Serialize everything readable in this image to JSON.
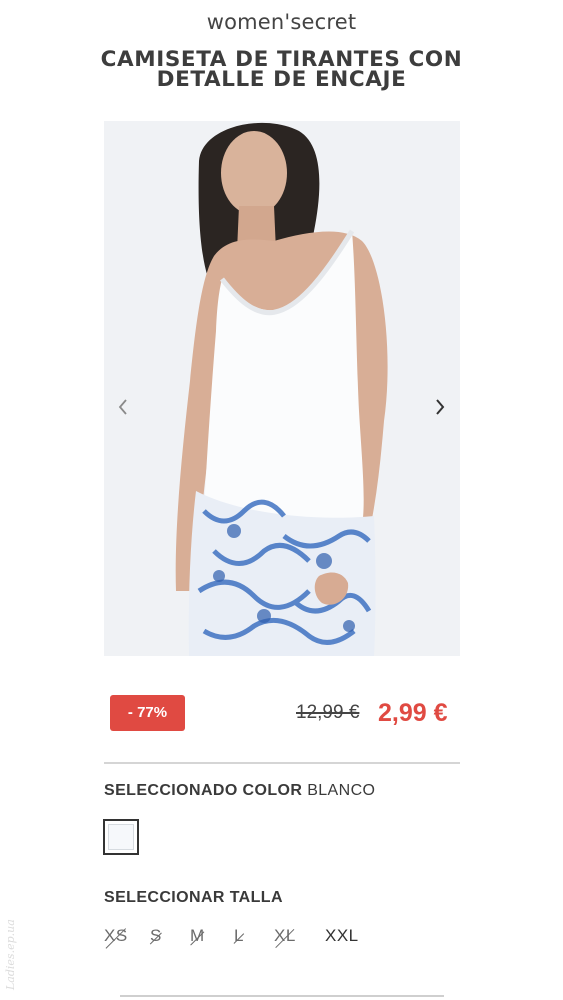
{
  "header": {
    "brand": "women'secret",
    "product_title": "CAMISETA DE TIRANTES CON DETALLE DE ENCAJE"
  },
  "gallery": {
    "prev_icon": "chevron-left-icon",
    "next_icon": "chevron-right-icon"
  },
  "pricing": {
    "discount_badge": "- 77%",
    "old_price": "12,99 €",
    "new_price": "2,99 €",
    "accent_color": "#e04a42"
  },
  "color": {
    "label_bold": "SELECCIONADO COLOR",
    "value": "BLANCO"
  },
  "size": {
    "label": "SELECCIONAR TALLA",
    "options": [
      {
        "label": "XS",
        "available": false
      },
      {
        "label": "S",
        "available": false
      },
      {
        "label": "M",
        "available": false
      },
      {
        "label": "L",
        "available": false
      },
      {
        "label": "XL",
        "available": false
      },
      {
        "label": "XXL",
        "available": true
      }
    ]
  },
  "watermark": "Ladies.ep.ua"
}
